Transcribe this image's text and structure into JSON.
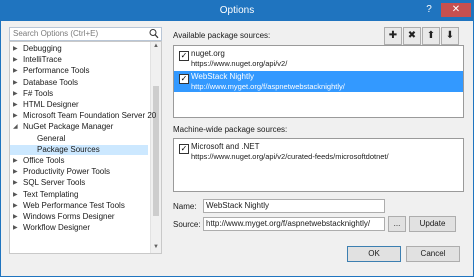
{
  "window": {
    "title": "Options",
    "help_glyph": "?",
    "close_glyph": "✕"
  },
  "search": {
    "placeholder": "Search Options (Ctrl+E)"
  },
  "tree": [
    {
      "label": "Debugging",
      "arrow": "▶",
      "child": false,
      "selected": false
    },
    {
      "label": "IntelliTrace",
      "arrow": "▶",
      "child": false,
      "selected": false
    },
    {
      "label": "Performance Tools",
      "arrow": "▶",
      "child": false,
      "selected": false
    },
    {
      "label": "Database Tools",
      "arrow": "▶",
      "child": false,
      "selected": false
    },
    {
      "label": "F# Tools",
      "arrow": "▶",
      "child": false,
      "selected": false
    },
    {
      "label": "HTML Designer",
      "arrow": "▶",
      "child": false,
      "selected": false
    },
    {
      "label": "Microsoft Team Foundation Server 20",
      "arrow": "▶",
      "child": false,
      "selected": false
    },
    {
      "label": "NuGet Package Manager",
      "arrow": "◢",
      "child": false,
      "selected": false
    },
    {
      "label": "General",
      "arrow": "",
      "child": true,
      "selected": false
    },
    {
      "label": "Package Sources",
      "arrow": "",
      "child": true,
      "selected": true
    },
    {
      "label": "Office Tools",
      "arrow": "▶",
      "child": false,
      "selected": false
    },
    {
      "label": "Productivity Power Tools",
      "arrow": "▶",
      "child": false,
      "selected": false
    },
    {
      "label": "SQL Server Tools",
      "arrow": "▶",
      "child": false,
      "selected": false
    },
    {
      "label": "Text Templating",
      "arrow": "▶",
      "child": false,
      "selected": false
    },
    {
      "label": "Web Performance Test Tools",
      "arrow": "▶",
      "child": false,
      "selected": false
    },
    {
      "label": "Windows Forms Designer",
      "arrow": "▶",
      "child": false,
      "selected": false
    },
    {
      "label": "Workflow Designer",
      "arrow": "▶",
      "child": false,
      "selected": false
    }
  ],
  "available": {
    "label": "Available package sources:",
    "sources": [
      {
        "name": "nuget.org",
        "url": "https://www.nuget.org/api/v2/",
        "checked": true,
        "selected": false
      },
      {
        "name": "WebStack Nightly",
        "url": "http://www.myget.org/f/aspnetwebstacknightly/",
        "checked": true,
        "selected": true
      }
    ]
  },
  "machine": {
    "label": "Machine-wide package sources:",
    "sources": [
      {
        "name": "Microsoft and .NET",
        "url": "https://www.nuget.org/api/v2/curated-feeds/microsoftdotnet/",
        "checked": true,
        "selected": false
      }
    ]
  },
  "toolbar": {
    "add_glyph": "✚",
    "remove_glyph": "✖",
    "up_glyph": "⬆",
    "down_glyph": "⬇"
  },
  "form": {
    "name_label": "Name:",
    "name_value": "WebStack Nightly",
    "source_label": "Source:",
    "source_value": "http://www.myget.org/f/aspnetwebstacknightly/",
    "browse_label": "...",
    "update_label": "Update"
  },
  "footer": {
    "ok_label": "OK",
    "cancel_label": "Cancel"
  },
  "checkmark": "✓"
}
